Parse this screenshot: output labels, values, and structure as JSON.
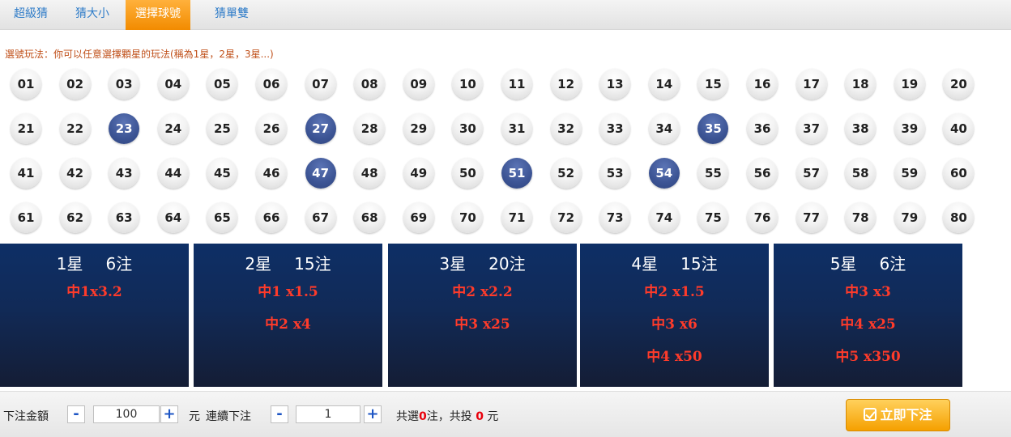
{
  "tabs": [
    {
      "label": "超級猜",
      "active": false
    },
    {
      "label": "猜大小",
      "active": false
    },
    {
      "label": "選擇球號",
      "active": true
    },
    {
      "label": "猜單雙",
      "active": false
    }
  ],
  "instruction": "選號玩法：你可以任意選擇顆星的玩法(稱為1星，2星，3星...)",
  "balls": {
    "numbers": [
      "01",
      "02",
      "03",
      "04",
      "05",
      "06",
      "07",
      "08",
      "09",
      "10",
      "11",
      "12",
      "13",
      "14",
      "15",
      "16",
      "17",
      "18",
      "19",
      "20",
      "21",
      "22",
      "23",
      "24",
      "25",
      "26",
      "27",
      "28",
      "29",
      "30",
      "31",
      "32",
      "33",
      "34",
      "35",
      "36",
      "37",
      "38",
      "39",
      "40",
      "41",
      "42",
      "43",
      "44",
      "45",
      "46",
      "47",
      "48",
      "49",
      "50",
      "51",
      "52",
      "53",
      "54",
      "55",
      "56",
      "57",
      "58",
      "59",
      "60",
      "61",
      "62",
      "63",
      "64",
      "65",
      "66",
      "67",
      "68",
      "69",
      "70",
      "71",
      "72",
      "73",
      "74",
      "75",
      "76",
      "77",
      "78",
      "79",
      "80"
    ],
    "selected": [
      "23",
      "27",
      "35",
      "47",
      "51",
      "54"
    ]
  },
  "panels": [
    {
      "stars": "1星",
      "bets": "6注",
      "payouts": [
        "中1x3.2"
      ]
    },
    {
      "stars": "2星",
      "bets": "15注",
      "payouts": [
        "中1 x1.5",
        "中2 x4"
      ]
    },
    {
      "stars": "3星",
      "bets": "20注",
      "payouts": [
        "中2 x2.2",
        "中3 x25"
      ]
    },
    {
      "stars": "4星",
      "bets": "15注",
      "payouts": [
        "中2 x1.5",
        "中3 x6",
        "中4 x50"
      ]
    },
    {
      "stars": "5星",
      "bets": "6注",
      "payouts": [
        "中3 x3",
        "中4 x25",
        "中5 x350"
      ]
    }
  ],
  "bottom": {
    "amount_label": "下注金額",
    "amount_value": "100",
    "unit_label": "元",
    "continuous_label": "連續下注",
    "continuous_value": "1",
    "minus": "-",
    "plus": "+",
    "summary_prefix": "共選",
    "selected_count": "0",
    "summary_mid": "注，共投",
    "total": "0",
    "summary_suffix": "元",
    "submit_label": "立即下注"
  },
  "colors": {
    "accent": "#f28b00",
    "tab_text": "#2f7cc8",
    "selected_ball": "#3c5494",
    "panel_bg": "#112a57",
    "payout_red": "#ff3b2a"
  }
}
